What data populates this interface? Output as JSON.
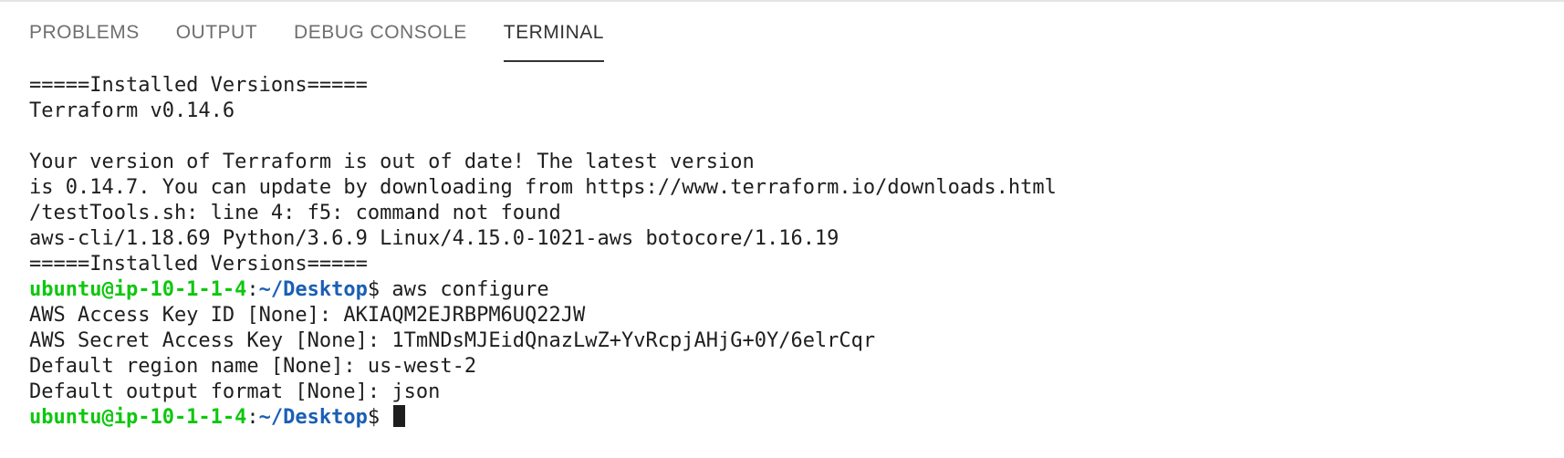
{
  "tabs": [
    {
      "label": "PROBLEMS",
      "active": false
    },
    {
      "label": "OUTPUT",
      "active": false
    },
    {
      "label": "DEBUG CONSOLE",
      "active": false
    },
    {
      "label": "TERMINAL",
      "active": true
    }
  ],
  "terminal": {
    "lines": [
      "=====Installed Versions=====",
      "Terraform v0.14.6",
      "",
      "Your version of Terraform is out of date! The latest version",
      "is 0.14.7. You can update by downloading from https://www.terraform.io/downloads.html",
      "/testTools.sh: line 4: f5: command not found",
      "aws-cli/1.18.69 Python/3.6.9 Linux/4.15.0-1021-aws botocore/1.16.19",
      "=====Installed Versions====="
    ],
    "prompt1": {
      "user_host": "ubuntu@ip-10-1-1-4",
      "colon": ":",
      "path": "~/Desktop",
      "symbol": "$ ",
      "command": "aws configure"
    },
    "config_lines": [
      "AWS Access Key ID [None]: AKIAQM2EJRBPM6UQ22JW",
      "AWS Secret Access Key [None]: 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",
      "Default region name [None]: us-west-2",
      "Default output format [None]: json"
    ],
    "prompt2": {
      "user_host": "ubuntu@ip-10-1-1-4",
      "colon": ":",
      "path": "~/Desktop",
      "symbol": "$ ",
      "command": ""
    }
  },
  "colors": {
    "prompt_user": "#0ec70e",
    "prompt_path": "#1a5fb4",
    "text": "#1e1e1e",
    "tab_inactive": "#6f6f6f",
    "tab_active": "#333333"
  }
}
